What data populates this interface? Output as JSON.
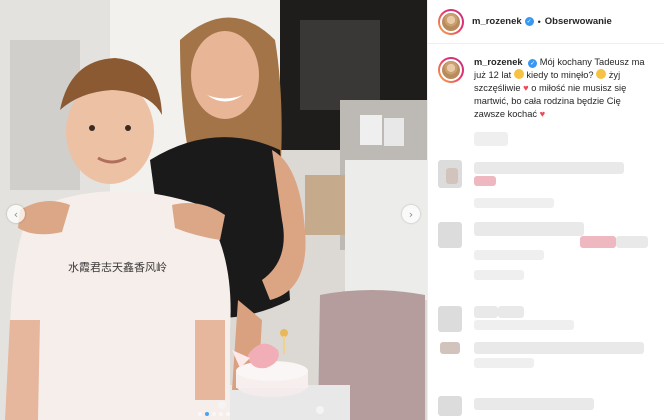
{
  "post": {
    "username": "m_rozenek",
    "follow_label": "Obserwowanie",
    "separator": "•",
    "verified_glyph": "✓",
    "caption": {
      "username": "m_rozenek",
      "text_1": "Mój kochany Tadeusz ma już 12 lat",
      "text_2": "kiedy to minęło?",
      "text_3": "żyj szczęśliwie",
      "text_4": "o miłość nie musisz się martwić, bo cała rodzina będzie Cię zawsze kochać"
    },
    "carousel": {
      "slide_count": 5,
      "active_slide": 1,
      "prev_glyph": "‹",
      "next_glyph": "›"
    }
  },
  "icons": {
    "heart": "♥",
    "verified": "verified-badge-icon",
    "emoji": "grinning-face-icon"
  },
  "colors": {
    "verified_blue": "#3897f0",
    "heart_red": "#ed4956",
    "text": "#262626",
    "border": "#efefef"
  }
}
